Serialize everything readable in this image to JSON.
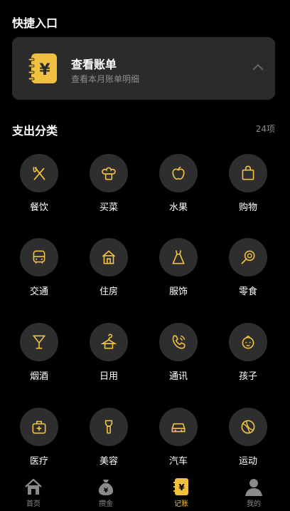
{
  "quick_entry": {
    "title": "快捷入口",
    "card": {
      "icon": "ledger-yen-icon",
      "title": "查看账单",
      "subtitle": "查看本月账单明细",
      "chevron": "chevron-up-icon"
    }
  },
  "categories": {
    "title": "支出分类",
    "count": "24项",
    "items": [
      {
        "label": "餐饮",
        "icon": "dining-icon"
      },
      {
        "label": "买菜",
        "icon": "groceries-icon"
      },
      {
        "label": "水果",
        "icon": "fruit-icon"
      },
      {
        "label": "购物",
        "icon": "shopping-bag-icon"
      },
      {
        "label": "交通",
        "icon": "bus-icon"
      },
      {
        "label": "住房",
        "icon": "house-icon"
      },
      {
        "label": "服饰",
        "icon": "dress-icon"
      },
      {
        "label": "零食",
        "icon": "lollipop-icon"
      },
      {
        "label": "烟酒",
        "icon": "cocktail-icon"
      },
      {
        "label": "日用",
        "icon": "hanger-icon"
      },
      {
        "label": "通讯",
        "icon": "phone-icon"
      },
      {
        "label": "孩子",
        "icon": "baby-icon"
      },
      {
        "label": "医疗",
        "icon": "medical-kit-icon"
      },
      {
        "label": "美容",
        "icon": "beauty-icon"
      },
      {
        "label": "汽车",
        "icon": "car-icon"
      },
      {
        "label": "运动",
        "icon": "ball-icon"
      }
    ]
  },
  "tabbar": {
    "items": [
      {
        "label": "首页",
        "icon": "home-icon",
        "active": false
      },
      {
        "label": "攒金",
        "icon": "money-bag-icon",
        "active": false
      },
      {
        "label": "记账",
        "icon": "ledger-yen-icon",
        "active": true
      },
      {
        "label": "我的",
        "icon": "user-icon",
        "active": false
      }
    ]
  },
  "colors": {
    "accent": "#f0c040",
    "background": "#000000",
    "card": "#2b2b2b",
    "circle": "#2e2e2e",
    "muted_text": "#8a8a8a"
  }
}
